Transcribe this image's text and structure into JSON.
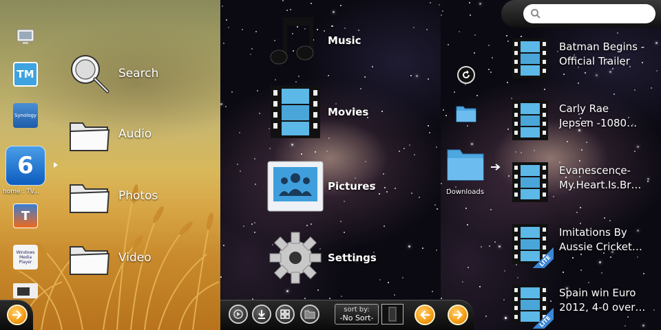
{
  "left_panel": {
    "dock_label": "home : TV...",
    "dock_apps": [
      "monitor-app-icon",
      "tvmobili-app-icon",
      "synology-app-icon",
      "home-tv-app-icon",
      "tversity-app-icon",
      "windows-media-player-app-icon",
      "media-app-icon"
    ],
    "dock_app_texts": {
      "tvmobili": "TM",
      "synology": "Synology",
      "home": "6",
      "tversity": "T",
      "wmp": "Windows Media Player"
    },
    "items": [
      {
        "label": "Search",
        "icon": "magnifier-icon"
      },
      {
        "label": "Audio",
        "icon": "folder-icon"
      },
      {
        "label": "Photos",
        "icon": "folder-icon"
      },
      {
        "label": "Video",
        "icon": "folder-icon"
      }
    ]
  },
  "middle_panel": {
    "items": [
      {
        "label": "Music",
        "icon": "music-note-icon"
      },
      {
        "label": "Movies",
        "icon": "film-strip-icon"
      },
      {
        "label": "Pictures",
        "icon": "pictures-icon"
      },
      {
        "label": "Settings",
        "icon": "gear-icon"
      }
    ],
    "toolbar": {
      "sort_label": "sort by:",
      "sort_value": "-No Sort-"
    }
  },
  "right_panel": {
    "search": {
      "placeholder": "",
      "value": ""
    },
    "folder_label": "Downloads",
    "videos": [
      {
        "line1": "Batman Begins -",
        "line2": "Official Trailer",
        "lite": false
      },
      {
        "line1": "Carly Rae",
        "line2": "Jepsen -1080…",
        "lite": false
      },
      {
        "line1": "Evanescence-",
        "line2": "My.Heart.Is.Br…",
        "lite": false
      },
      {
        "line1": "Imitations By",
        "line2": "Aussie Cricket…",
        "lite": true
      },
      {
        "line1": "Spain win Euro",
        "line2": "2012, 4-0 over…",
        "lite": true
      }
    ],
    "lite_badge": "LITE"
  },
  "colors": {
    "accent_orange": "#f49b14",
    "film_blue": "#5cb8e6",
    "folder_blue": "#4fa7e0"
  }
}
